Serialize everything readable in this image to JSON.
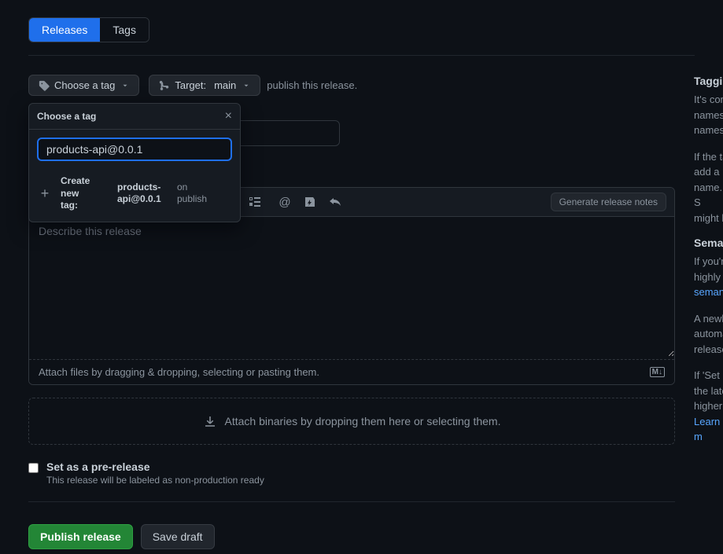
{
  "tabs": {
    "releases": "Releases",
    "tags": "Tags"
  },
  "choose_tag": {
    "label": "Choose a tag"
  },
  "target": {
    "label": "Target:",
    "value": "main"
  },
  "publish_hint": "publish this release.",
  "popover": {
    "title": "Choose a tag",
    "input_value": "products-api@0.0.1",
    "create_label1": "Create new",
    "create_label2": "tag:",
    "tag_name1": "products-",
    "tag_name2": "api@0.0.1",
    "on": "on",
    "publish": "publish"
  },
  "toolbar": {
    "gen_notes": "Generate release notes"
  },
  "textarea_placeholder": "Describe this release",
  "attach_text": "Attach files by dragging & dropping, selecting or pasting them.",
  "dropzone_text": "Attach binaries by dropping them here or selecting them.",
  "prerelease": {
    "label": "Set as a pre-release",
    "desc": "This release will be labeled as non-production ready"
  },
  "actions": {
    "publish": "Publish release",
    "draft": "Save draft"
  },
  "sidebar": {
    "h1": "Taggin",
    "p1": "It's con",
    "p2": "names",
    "p3": "names",
    "p4": "If the ta",
    "p5": "add a p",
    "p6": "name. S",
    "p7": "might b",
    "h2": "Seman",
    "p8": "If you'r",
    "p9": "highly r",
    "link1": "semant",
    "p10": "A newly",
    "p11": "automa",
    "p12": "release",
    "p13": "If 'Set a",
    "p14": "the late",
    "p15": "higher",
    "link2": "Learn m"
  }
}
